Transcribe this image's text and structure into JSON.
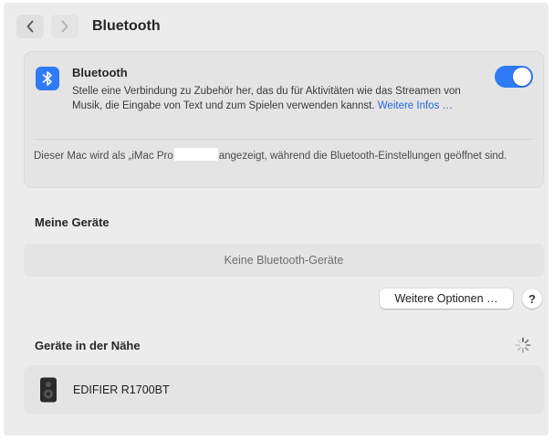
{
  "window": {
    "title": "Bluetooth"
  },
  "bluetooth": {
    "label": "Bluetooth",
    "description": "Stelle eine Verbindung zu Zubehör her, das du für Aktivitäten wie das Streamen von Musik, die Eingabe von Text und zum Spielen verwenden kannst.",
    "more_info_link": "Weitere Infos …",
    "enabled": true,
    "note_before": "Dieser Mac wird als „iMac Pro",
    "note_after": "angezeigt, während die Bluetooth-Einstellungen geöffnet sind."
  },
  "my_devices": {
    "heading": "Meine Geräte",
    "empty_label": "Keine Bluetooth-Geräte"
  },
  "buttons": {
    "more_options": "Weitere Optionen …",
    "help": "?"
  },
  "nearby_devices": {
    "heading": "Geräte in der Nähe",
    "items": [
      {
        "name": "EDIFIER R1700BT",
        "icon": "speaker-icon"
      }
    ]
  },
  "colors": {
    "accent": "#2f7bf5",
    "link": "#2568d8"
  }
}
